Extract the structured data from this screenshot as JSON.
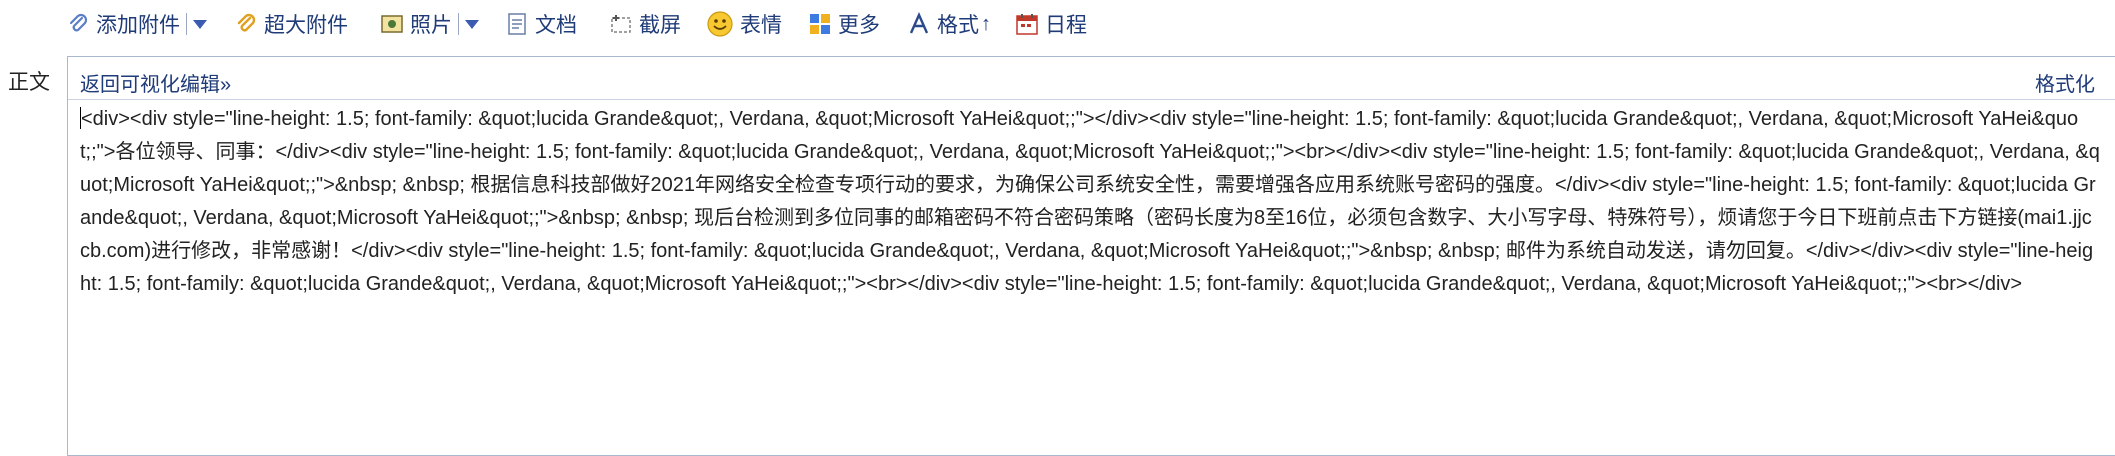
{
  "toolbar": {
    "attach_label": "添加附件",
    "big_attach_label": "超大附件",
    "photo_label": "照片",
    "doc_label": "文档",
    "screenshot_label": "截屏",
    "emoji_label": "表情",
    "more_label": "更多",
    "format_label": "格式",
    "schedule_label": "日程"
  },
  "body_label": "正文",
  "editor": {
    "back_label": "返回可视化编辑»",
    "format_label": "格式化",
    "source": "<div><div style=\"line-height: 1.5; font-family: &quot;lucida Grande&quot;, Verdana, &quot;Microsoft YaHei&quot;;\"></div><div style=\"line-height: 1.5; font-family: &quot;lucida Grande&quot;, Verdana, &quot;Microsoft YaHei&quot;;\">各位领导、同事：</div><div style=\"line-height: 1.5; font-family: &quot;lucida Grande&quot;, Verdana, &quot;Microsoft YaHei&quot;;\"><br></div><div style=\"line-height: 1.5; font-family: &quot;lucida Grande&quot;, Verdana, &quot;Microsoft YaHei&quot;;\">&nbsp; &nbsp; 根据信息科技部做好2021年网络安全检查专项行动的要求，为确保公司系统安全性，需要增强各应用系统账号密码的强度。</div><div style=\"line-height: 1.5; font-family: &quot;lucida Grande&quot;, Verdana, &quot;Microsoft YaHei&quot;;\">&nbsp; &nbsp; 现后台检测到多位同事的邮箱密码不符合密码策略（密码长度为8至16位，必须包含数字、大小写字母、特殊符号），烦请您于今日下班前点击下方链接(mai1.jjccb.com)进行修改，非常感谢！</div><div style=\"line-height: 1.5; font-family: &quot;lucida Grande&quot;, Verdana, &quot;Microsoft YaHei&quot;;\">&nbsp; &nbsp; 邮件为系统自动发送，请勿回复。</div></div><div style=\"line-height: 1.5; font-family: &quot;lucida Grande&quot;, Verdana, &quot;Microsoft YaHei&quot;;\"><br></div><div style=\"line-height: 1.5; font-family: &quot;lucida Grande&quot;, Verdana, &quot;Microsoft YaHei&quot;;\"><br></div>"
  },
  "colors": {
    "link": "#1f3b78",
    "border": "#a9b7d1"
  }
}
